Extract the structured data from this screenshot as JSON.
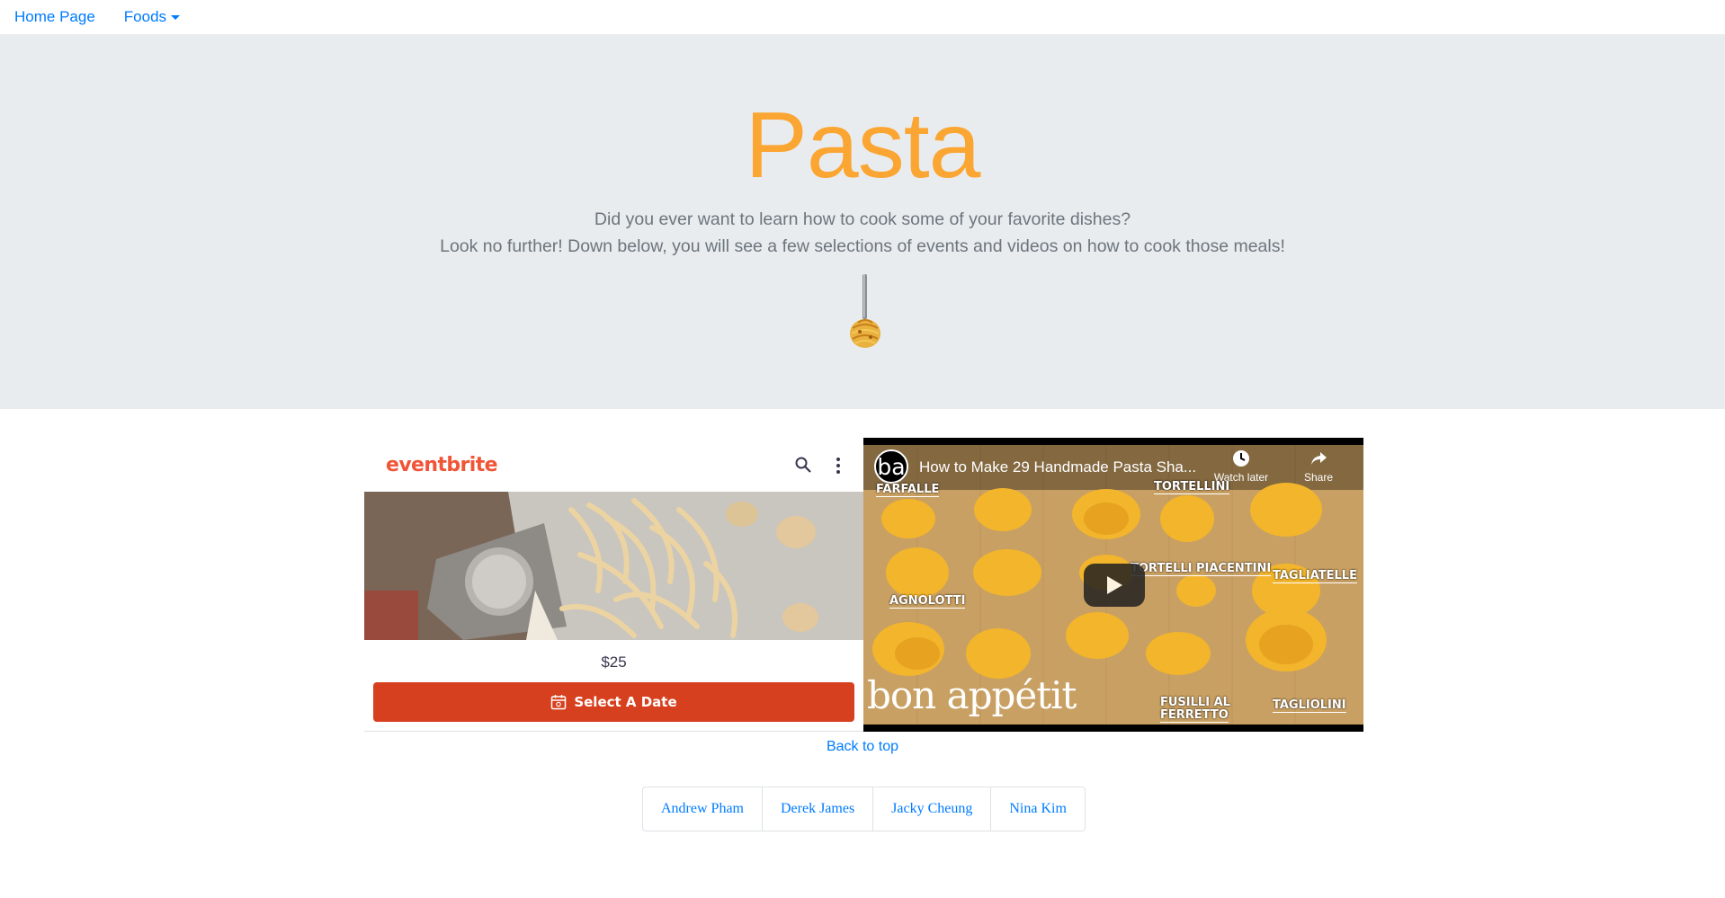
{
  "nav": {
    "home_label": "Home Page",
    "foods_label": "Foods"
  },
  "hero": {
    "title": "Pasta",
    "line1": "Did you ever want to learn how to cook some of your favorite dishes?",
    "line2": "Look no further! Down below, you will see a few selections of events and videos on how to cook those meals!",
    "image_icon": "fork-with-spaghetti"
  },
  "event": {
    "brand": "eventbrite",
    "price": "$25",
    "button_label": "Select A Date",
    "icons": [
      "search-icon",
      "more-vertical-icon",
      "calendar-icon"
    ]
  },
  "video": {
    "channel_avatar": "ba",
    "title": "How to Make 29 Handmade Pasta Sha...",
    "watch_later_label": "Watch later",
    "share_label": "Share",
    "brand_watermark": "bon appétit",
    "labels": [
      "FARFALLE",
      "TORTELLINI",
      "AGNOLOTTI",
      "TORTELLI PIACENTINI",
      "TAGLIATELLE",
      "FUSILLI AL",
      "FERRETTO",
      "TAGLIOLINI"
    ]
  },
  "footer": {
    "back_to_top": "Back to top",
    "authors": [
      "Andrew Pham",
      "Derek James",
      "Jacky Cheung",
      "Nina Kim"
    ]
  },
  "colors": {
    "title_orange": "#fba532",
    "link_blue": "#007bff",
    "eventbrite_orange": "#d6401e",
    "jumbotron_bg": "#e9ecef"
  }
}
